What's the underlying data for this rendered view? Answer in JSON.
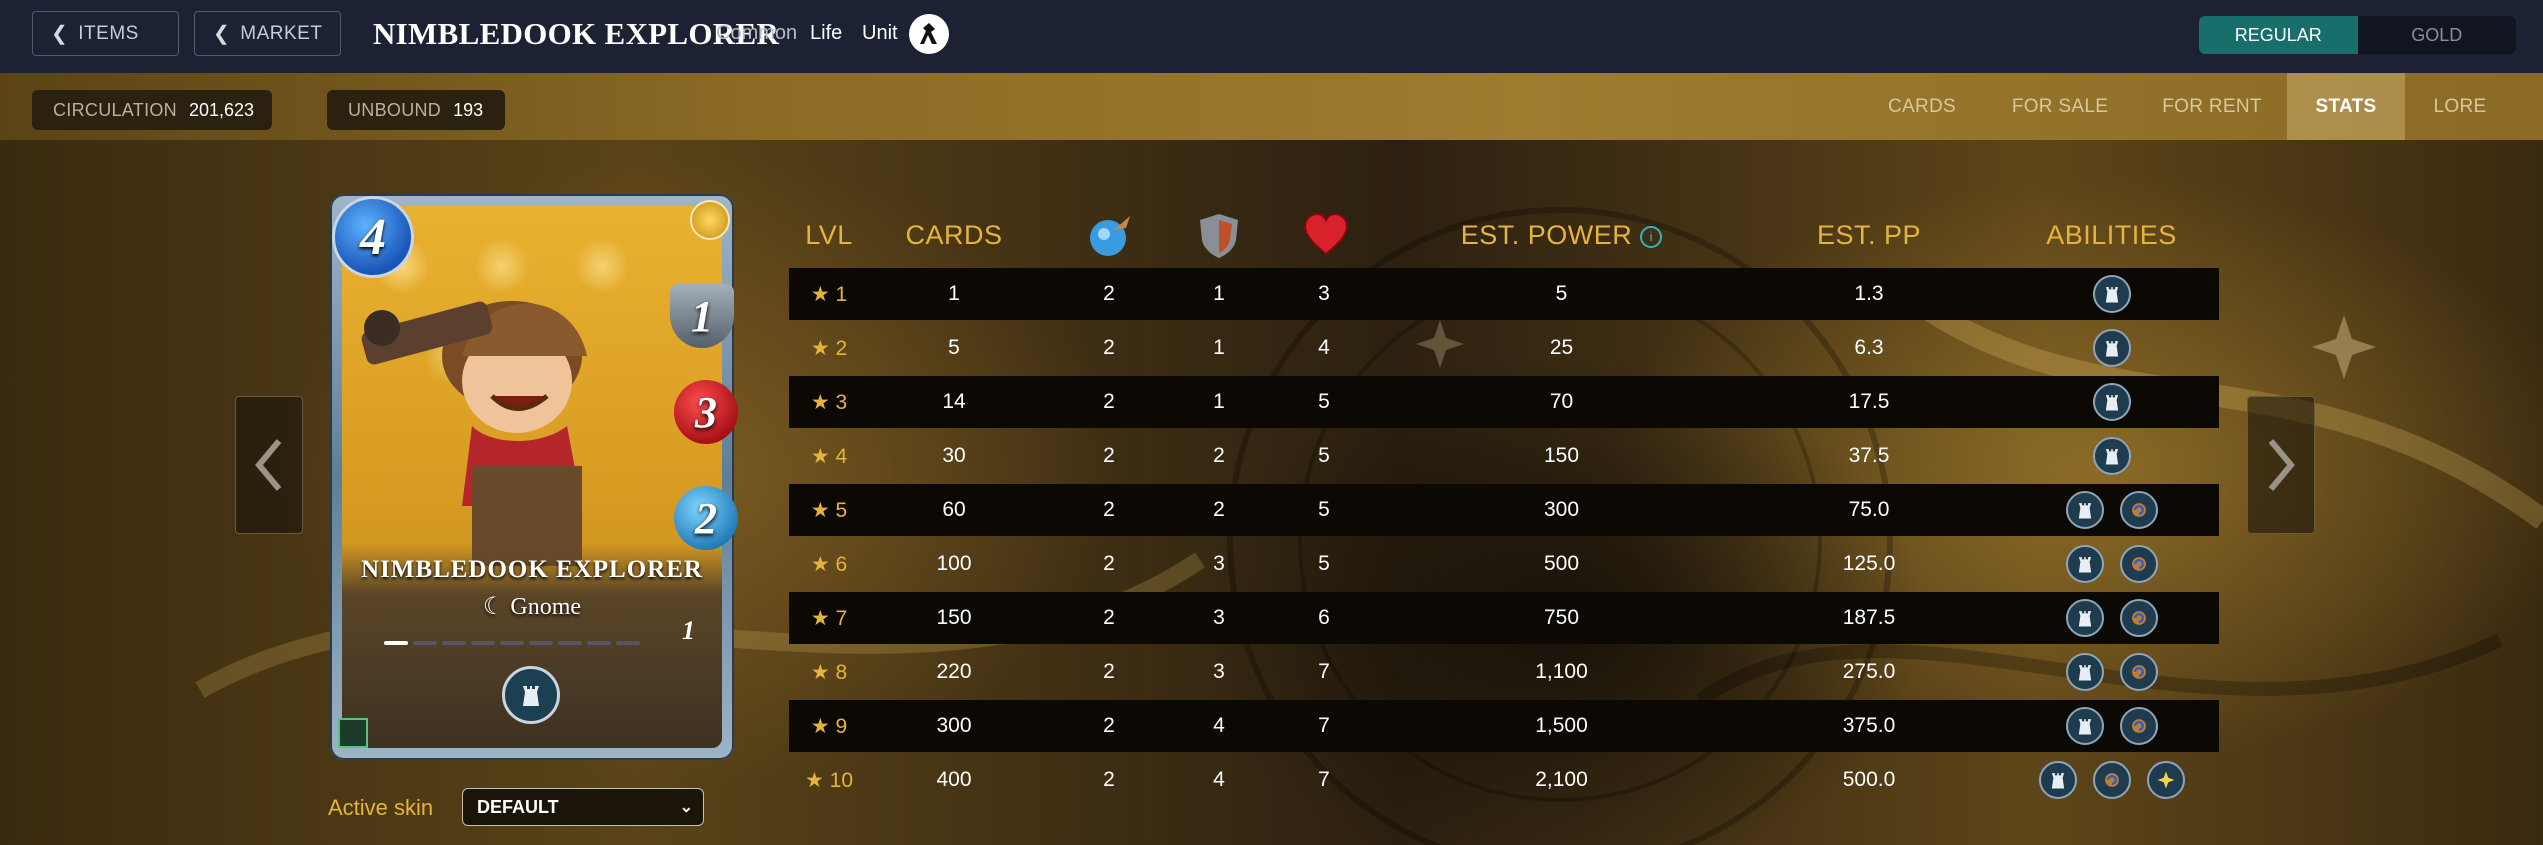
{
  "header": {
    "items_label": "ITEMS",
    "market_label": "MARKET",
    "title": "NIMBLEDOOK EXPLORER",
    "rarity": "Common",
    "element": "Life",
    "type": "Unit",
    "toggle": {
      "regular": "REGULAR",
      "gold": "GOLD",
      "selected": "REGULAR"
    }
  },
  "subbar": {
    "circulation_label": "CIRCULATION",
    "circulation_value": "201,623",
    "unbound_label": "UNBOUND",
    "unbound_value": "193",
    "tabs": [
      "CARDS",
      "FOR SALE",
      "FOR RENT",
      "STATS",
      "LORE"
    ],
    "active_tab": "STATS"
  },
  "card": {
    "name": "NIMBLEDOOK EXPLORER",
    "race": "Gnome",
    "mana": "4",
    "armor": "1",
    "health": "3",
    "ranged": "2",
    "level": "1",
    "level_segments_on": 1,
    "level_segments_total": 10
  },
  "skin": {
    "label": "Active skin",
    "value": "DEFAULT"
  },
  "table": {
    "headers": {
      "lvl": "LVL",
      "cards": "CARDS",
      "ranged_icon": "ranged-attack-icon",
      "armor_icon": "armor-icon",
      "health_icon": "health-icon",
      "power": "EST. POWER",
      "pp": "EST. PP",
      "abilities": "ABILITIES"
    },
    "rows": [
      {
        "lvl": "★ 1",
        "cards": "1",
        "ranged": "2",
        "armor": "1",
        "health": "3",
        "power": "5",
        "pp": "1.3",
        "abilities": 1
      },
      {
        "lvl": "★ 2",
        "cards": "5",
        "ranged": "2",
        "armor": "1",
        "health": "4",
        "power": "25",
        "pp": "6.3",
        "abilities": 1
      },
      {
        "lvl": "★ 3",
        "cards": "14",
        "ranged": "2",
        "armor": "1",
        "health": "5",
        "power": "70",
        "pp": "17.5",
        "abilities": 1
      },
      {
        "lvl": "★ 4",
        "cards": "30",
        "ranged": "2",
        "armor": "2",
        "health": "5",
        "power": "150",
        "pp": "37.5",
        "abilities": 1
      },
      {
        "lvl": "★ 5",
        "cards": "60",
        "ranged": "2",
        "armor": "2",
        "health": "5",
        "power": "300",
        "pp": "75.0",
        "abilities": 2
      },
      {
        "lvl": "★ 6",
        "cards": "100",
        "ranged": "2",
        "armor": "3",
        "health": "5",
        "power": "500",
        "pp": "125.0",
        "abilities": 2
      },
      {
        "lvl": "★ 7",
        "cards": "150",
        "ranged": "2",
        "armor": "3",
        "health": "6",
        "power": "750",
        "pp": "187.5",
        "abilities": 2
      },
      {
        "lvl": "★ 8",
        "cards": "220",
        "ranged": "2",
        "armor": "3",
        "health": "7",
        "power": "1,100",
        "pp": "275.0",
        "abilities": 2
      },
      {
        "lvl": "★ 9",
        "cards": "300",
        "ranged": "2",
        "armor": "4",
        "health": "7",
        "power": "1,500",
        "pp": "375.0",
        "abilities": 2
      },
      {
        "lvl": "★ 10",
        "cards": "400",
        "ranged": "2",
        "armor": "4",
        "health": "7",
        "power": "2,100",
        "pp": "500.0",
        "abilities": 3
      }
    ],
    "ability_icons": [
      "ability-tower-icon",
      "ability-recharge-icon",
      "ability-spark-icon"
    ]
  },
  "colors": {
    "accent_gold": "#e6b43c",
    "toggle_active": "#176e6a",
    "topbar": "#1c2233"
  }
}
